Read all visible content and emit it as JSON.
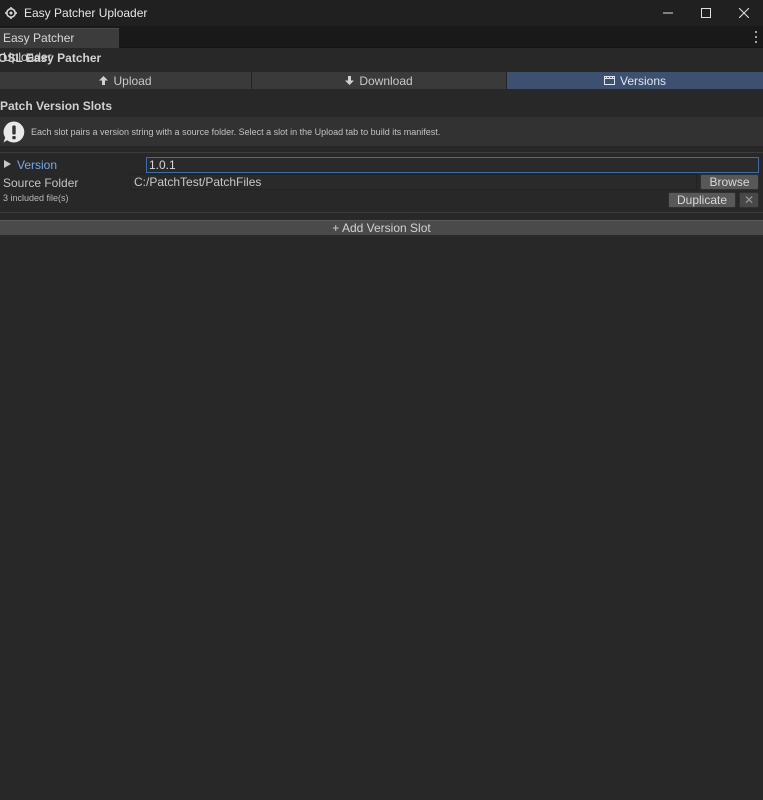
{
  "window": {
    "title": "Easy Patcher Uploader",
    "icon": "unity-gear-icon",
    "controls": [
      "minimize-icon",
      "maximize-icon",
      "close-icon"
    ]
  },
  "editor_tab": {
    "label": "Easy Patcher Uploader",
    "menu_icon": "kebab-menu-icon"
  },
  "header": {
    "label": "OSL Easy Patcher"
  },
  "toolbar": {
    "tabs": [
      {
        "label": "Upload",
        "icon": "arrow-up-icon",
        "active": false
      },
      {
        "label": "Download",
        "icon": "arrow-down-icon",
        "active": false
      },
      {
        "label": "Versions",
        "icon": "clapperboard-icon",
        "active": true
      }
    ],
    "active_color": "#3d5070"
  },
  "section": {
    "title": "Patch Version Slots",
    "help": {
      "icon": "info-bubble-icon",
      "text": "Each slot pairs a version string with a source folder. Select a slot in the Upload tab to build its manifest."
    }
  },
  "slots": [
    {
      "version_label": "Version",
      "version_value": "1.0.1",
      "folder_label": "Source Folder",
      "folder_value": "C:/PatchTest/PatchFiles",
      "browse_label": "Browse",
      "files_text": "3 included file(s)",
      "duplicate_label": "Duplicate",
      "remove_label": "✕"
    }
  ],
  "add_slot_label": "+ Add Version Slot",
  "colors": {
    "background": "#282828",
    "accent_blue": "#7aa7e8",
    "field_focus_border": "#3d6cab"
  }
}
